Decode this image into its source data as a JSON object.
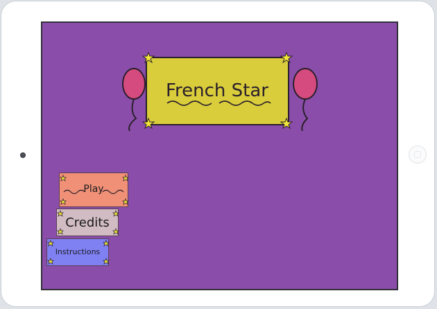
{
  "title": {
    "text": "French Star"
  },
  "menu": {
    "play_label": "Play",
    "credits_label": "Credits",
    "instructions_label": "Instructions"
  },
  "colors": {
    "screen_bg": "#8a4eaa",
    "title_panel": "#d9cd3c",
    "balloon": "#d64b7f",
    "play_button": "#ef9077",
    "credits_button": "#d1bcc3",
    "instructions_button": "#7f81f3",
    "star": "#f3e83a"
  },
  "icons": {
    "stars": "star-icon",
    "balloons": "balloon-icon",
    "camera": "camera-icon",
    "home": "home-button-icon"
  }
}
